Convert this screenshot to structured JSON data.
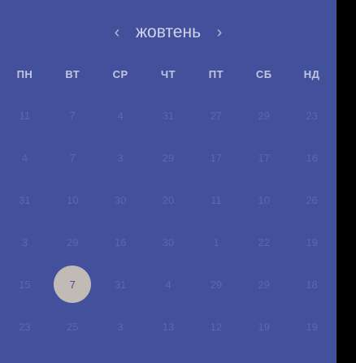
{
  "header": {
    "prev": "‹",
    "month": "жовтень",
    "next": "›"
  },
  "weekdays": [
    "ПН",
    "ВТ",
    "СР",
    "ЧТ",
    "ПТ",
    "СБ",
    "НД"
  ],
  "weeks": [
    [
      "11",
      "7",
      "4",
      "31",
      "27",
      "29",
      "23"
    ],
    [
      "4",
      "7",
      "3",
      "29",
      "17",
      "17",
      "16"
    ],
    [
      "31",
      "10",
      "30",
      "20",
      "11",
      "10",
      "26"
    ],
    [
      "3",
      "29",
      "16",
      "30",
      "1",
      "22",
      "19"
    ],
    [
      "15",
      "7",
      "31",
      "4",
      "29",
      "29",
      "18"
    ],
    [
      "23",
      "25",
      "3",
      "13",
      "12",
      "19",
      "19"
    ]
  ],
  "selected": {
    "week": 4,
    "day": 1
  },
  "colors": {
    "background": "#43519c",
    "dim_day": "#5b68ad",
    "selected_fill": "#c2bab4"
  }
}
